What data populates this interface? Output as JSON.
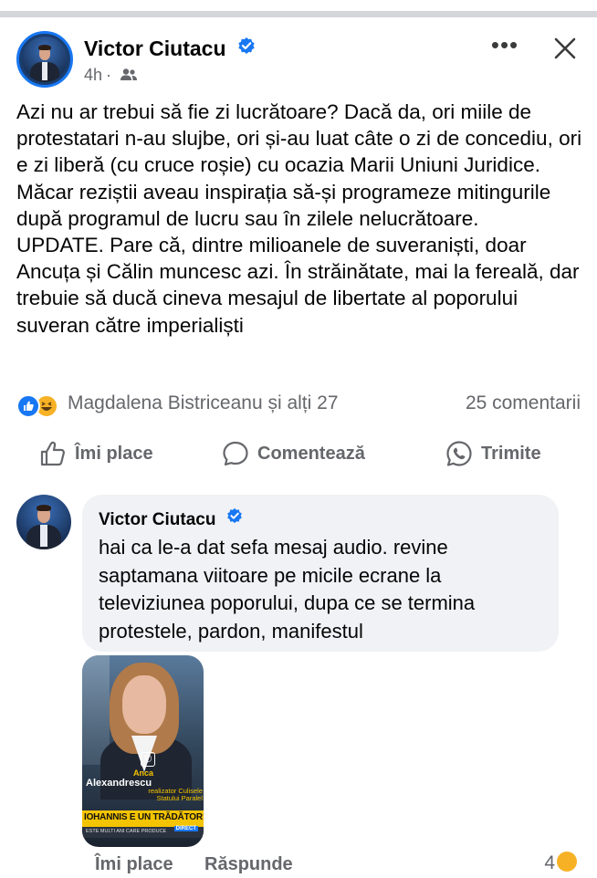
{
  "post": {
    "author": "Victor Ciutacu",
    "time": "4h",
    "separator": "·",
    "audience_icon": "friends-icon",
    "more_label": "•••",
    "text": "Azi nu ar trebui să fie zi lucrătoare? Dacă da, ori miile de protestatari n-au slujbe, ori și-au luat câte o zi de concediu, ori e zi liberă (cu cruce roșie) cu ocazia Marii Uniuni Juridice. Măcar reziștii aveau inspirația să-și programeze mitingurile după programul de lucru sau în zilele nelucrătoare.\nUPDATE. Pare că, dintre milioanele de suveraniști, doar Ancuța și Călin muncesc azi. În străinătate, mai la fereală, dar trebuie să ducă cineva mesajul de libertate al poporului suveran către imperialiști"
  },
  "reactions": {
    "names": "Magdalena Bistriceanu și alți 27",
    "comments": "25 comentarii",
    "types": [
      "like",
      "haha"
    ]
  },
  "actions": {
    "like": "Îmi place",
    "comment": "Comentează",
    "share": "Trimite"
  },
  "comment": {
    "author": "Victor Ciutacu",
    "text": "hai ca le-a dat sefa mesaj audio. revine saptamana viitoare pe micile ecrane la televiziunea poporului, dupa ce se termina protestele, pardon, manifestul",
    "image": {
      "first_name": "Anca",
      "last_name": "Alexandrescu",
      "subtitle": "realizator Culisele Statului Paralel",
      "banner": "IOHANNIS E UN TRĂDĂTOR!",
      "ticker": "ESTE MULTI ANI CARE PRODUCE",
      "live": "DIRECT"
    },
    "like_label": "Îmi place",
    "reply_label": "Răspunde",
    "reaction_count": "4"
  },
  "colors": {
    "accent": "#1877f2",
    "secondary_text": "#65676b",
    "bubble": "#f0f2f5",
    "haha": "#f7b125"
  }
}
